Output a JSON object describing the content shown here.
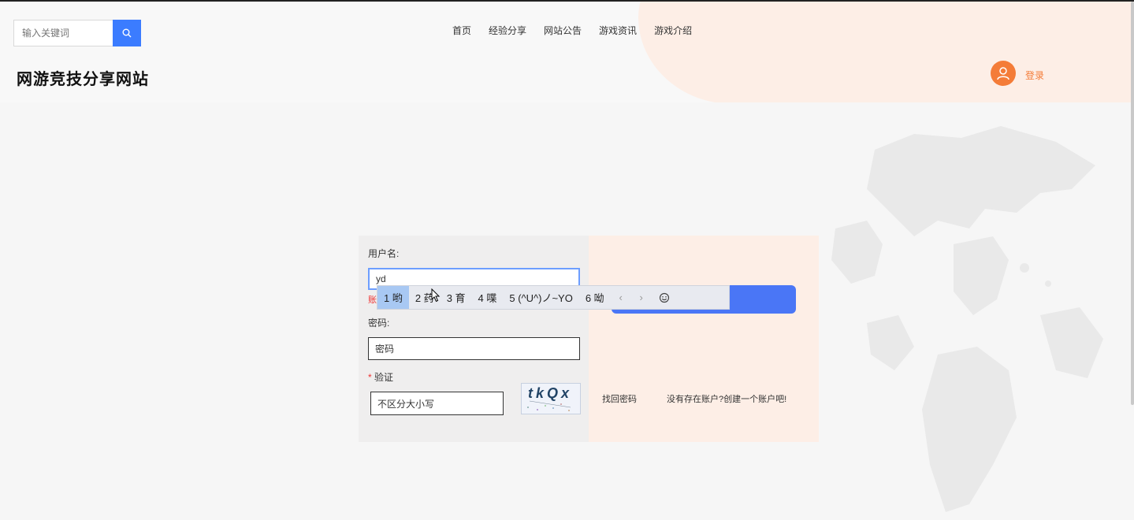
{
  "header": {
    "search": {
      "placeholder": "输入关键词",
      "icon": "search-icon"
    },
    "nav": [
      "首页",
      "经验分享",
      "网站公告",
      "游戏资讯",
      "游戏介绍"
    ],
    "site_title": "网游竞技分享网站",
    "login_label": "登录",
    "avatar_icon": "user-icon",
    "accent_color": "#f47c38",
    "primary_color": "#3b7cff"
  },
  "login_form": {
    "username_label": "用户名:",
    "username_value": "yd",
    "error_text": "账",
    "password_label": "密码:",
    "password_placeholder": "密码",
    "captcha_required_mark": "*",
    "captcha_label": "验证",
    "captcha_placeholder": "不区分大小写",
    "captcha_text": "tkQx",
    "forgot_password": "找回密码",
    "register_prompt": "没有存在账户?创建一个账户吧!"
  },
  "ime": {
    "candidates": [
      "1 哟",
      "2 药",
      "3 育",
      "4 喋",
      "5 (^U^)ノ~YO",
      "6 呦"
    ],
    "active_index": 0,
    "prev": "‹",
    "next": "›",
    "emoji_icon": "emoji-icon"
  }
}
